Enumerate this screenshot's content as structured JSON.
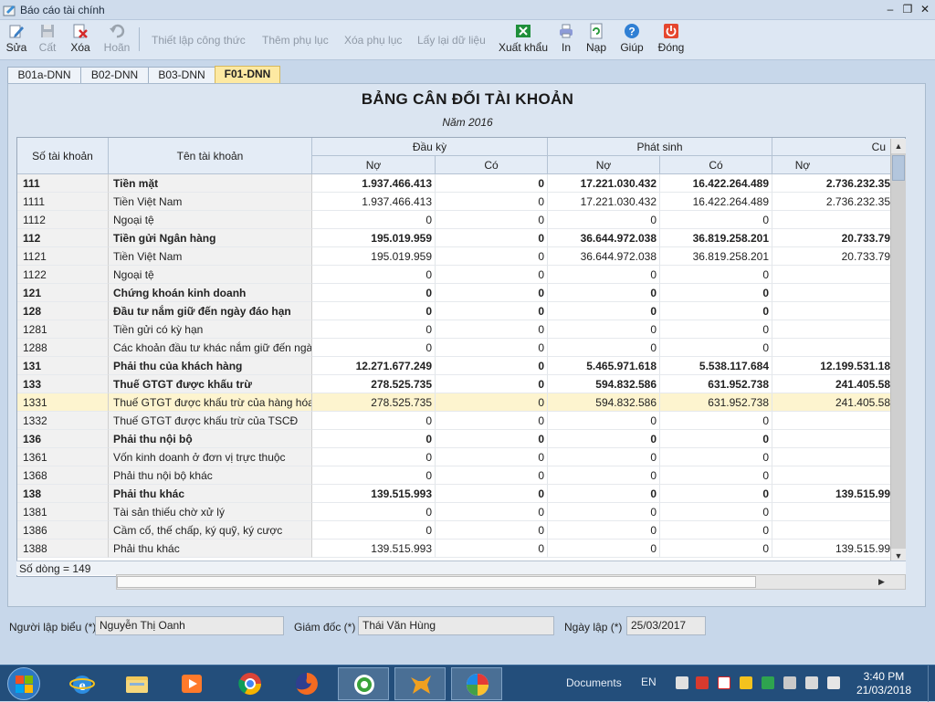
{
  "window": {
    "title": "Báo cáo tài chính"
  },
  "toolbar": {
    "edit": "Sửa",
    "save": "Cất",
    "delete": "Xóa",
    "undo": "Hoãn",
    "setup_formula": "Thiết lập công thức",
    "add_appendix": "Thêm phụ lục",
    "remove_appendix": "Xóa phụ lục",
    "reload_data": "Lấy lại dữ liệu",
    "export": "Xuất khẩu",
    "print": "In",
    "load": "Nạp",
    "help": "Giúp",
    "close": "Đóng"
  },
  "tabs": [
    "B01a-DNN",
    "B02-DNN",
    "B03-DNN",
    "F01-DNN"
  ],
  "active_tab": "F01-DNN",
  "report": {
    "title": "BẢNG CÂN ĐỐI TÀI KHOẢN",
    "year": "Năm 2016"
  },
  "grid": {
    "col_account_no": "Số tài khoản",
    "col_account_name": "Tên tài khoản",
    "group_opening": "Đầu kỳ",
    "group_movement": "Phát sinh",
    "group_closing": "Cu",
    "sub_debit": "Nợ",
    "sub_credit": "Có",
    "rows": [
      {
        "code": "111",
        "name": "Tiền mặt",
        "ob_debit": "1.937.466.413",
        "ob_credit": "0",
        "mv_debit": "17.221.030.432",
        "mv_credit": "16.422.264.489",
        "cl_debit": "2.736.232.35",
        "bold": true
      },
      {
        "code": "1111",
        "name": "Tiền Việt Nam",
        "ob_debit": "1.937.466.413",
        "ob_credit": "0",
        "mv_debit": "17.221.030.432",
        "mv_credit": "16.422.264.489",
        "cl_debit": "2.736.232.35",
        "bold": false
      },
      {
        "code": "1112",
        "name": "Ngoại tệ",
        "ob_debit": "0",
        "ob_credit": "0",
        "mv_debit": "0",
        "mv_credit": "0",
        "cl_debit": "",
        "bold": false
      },
      {
        "code": "112",
        "name": "Tiền gửi Ngân hàng",
        "ob_debit": "195.019.959",
        "ob_credit": "0",
        "mv_debit": "36.644.972.038",
        "mv_credit": "36.819.258.201",
        "cl_debit": "20.733.79",
        "bold": true
      },
      {
        "code": "1121",
        "name": "Tiền Việt Nam",
        "ob_debit": "195.019.959",
        "ob_credit": "0",
        "mv_debit": "36.644.972.038",
        "mv_credit": "36.819.258.201",
        "cl_debit": "20.733.79",
        "bold": false
      },
      {
        "code": "1122",
        "name": "Ngoại tệ",
        "ob_debit": "0",
        "ob_credit": "0",
        "mv_debit": "0",
        "mv_credit": "0",
        "cl_debit": "",
        "bold": false
      },
      {
        "code": "121",
        "name": "Chứng khoán kinh doanh",
        "ob_debit": "0",
        "ob_credit": "0",
        "mv_debit": "0",
        "mv_credit": "0",
        "cl_debit": "",
        "bold": true
      },
      {
        "code": "128",
        "name": "Đầu tư nắm giữ đến ngày đáo hạn",
        "ob_debit": "0",
        "ob_credit": "0",
        "mv_debit": "0",
        "mv_credit": "0",
        "cl_debit": "",
        "bold": true
      },
      {
        "code": "1281",
        "name": "Tiền gửi có kỳ hạn",
        "ob_debit": "0",
        "ob_credit": "0",
        "mv_debit": "0",
        "mv_credit": "0",
        "cl_debit": "",
        "bold": false
      },
      {
        "code": "1288",
        "name": "Các khoản đầu tư khác nắm giữ đến ngày...",
        "ob_debit": "0",
        "ob_credit": "0",
        "mv_debit": "0",
        "mv_credit": "0",
        "cl_debit": "",
        "bold": false
      },
      {
        "code": "131",
        "name": "Phải thu của khách hàng",
        "ob_debit": "12.271.677.249",
        "ob_credit": "0",
        "mv_debit": "5.465.971.618",
        "mv_credit": "5.538.117.684",
        "cl_debit": "12.199.531.18",
        "bold": true
      },
      {
        "code": "133",
        "name": "Thuế GTGT được khấu trừ",
        "ob_debit": "278.525.735",
        "ob_credit": "0",
        "mv_debit": "594.832.586",
        "mv_credit": "631.952.738",
        "cl_debit": "241.405.58",
        "bold": true
      },
      {
        "code": "1331",
        "name": "Thuế GTGT được khấu trừ của hàng hóa,...",
        "ob_debit": "278.525.735",
        "ob_credit": "0",
        "mv_debit": "594.832.586",
        "mv_credit": "631.952.738",
        "cl_debit": "241.405.58",
        "bold": false,
        "selected": true
      },
      {
        "code": "1332",
        "name": "Thuế GTGT được khấu trừ của TSCĐ",
        "ob_debit": "0",
        "ob_credit": "0",
        "mv_debit": "0",
        "mv_credit": "0",
        "cl_debit": "",
        "bold": false
      },
      {
        "code": "136",
        "name": "Phải thu nội bộ",
        "ob_debit": "0",
        "ob_credit": "0",
        "mv_debit": "0",
        "mv_credit": "0",
        "cl_debit": "",
        "bold": true
      },
      {
        "code": "1361",
        "name": "Vốn kinh doanh ở đơn vị trực thuộc",
        "ob_debit": "0",
        "ob_credit": "0",
        "mv_debit": "0",
        "mv_credit": "0",
        "cl_debit": "",
        "bold": false
      },
      {
        "code": "1368",
        "name": "Phải thu nội bộ khác",
        "ob_debit": "0",
        "ob_credit": "0",
        "mv_debit": "0",
        "mv_credit": "0",
        "cl_debit": "",
        "bold": false
      },
      {
        "code": "138",
        "name": "Phải thu khác",
        "ob_debit": "139.515.993",
        "ob_credit": "0",
        "mv_debit": "0",
        "mv_credit": "0",
        "cl_debit": "139.515.99",
        "bold": true
      },
      {
        "code": "1381",
        "name": "Tài sản thiếu chờ xử lý",
        "ob_debit": "0",
        "ob_credit": "0",
        "mv_debit": "0",
        "mv_credit": "0",
        "cl_debit": "",
        "bold": false
      },
      {
        "code": "1386",
        "name": "Cầm cố, thế chấp, ký quỹ, ký cược",
        "ob_debit": "0",
        "ob_credit": "0",
        "mv_debit": "0",
        "mv_credit": "0",
        "cl_debit": "",
        "bold": false
      },
      {
        "code": "1388",
        "name": "Phải thu khác",
        "ob_debit": "139.515.993",
        "ob_credit": "0",
        "mv_debit": "0",
        "mv_credit": "0",
        "cl_debit": "139.515.99",
        "bold": false
      }
    ],
    "row_count_label": "Số dòng = 149"
  },
  "signatures": {
    "preparer_label": "Người lập biểu (*)",
    "preparer_value": "Nguyễn Thị Oanh",
    "director_label": "Giám đốc (*)",
    "director_value": "Thái Văn Hùng",
    "date_label": "Ngày lập (*)",
    "date_value": "25/03/2017"
  },
  "taskbar": {
    "documents": "Documents",
    "language": "EN",
    "time": "3:40 PM",
    "date": "21/03/2018"
  },
  "colors": {
    "accent_tab": "#fde9a2",
    "selected_row": "#fdf4cf",
    "taskbar": "#234e7b"
  }
}
